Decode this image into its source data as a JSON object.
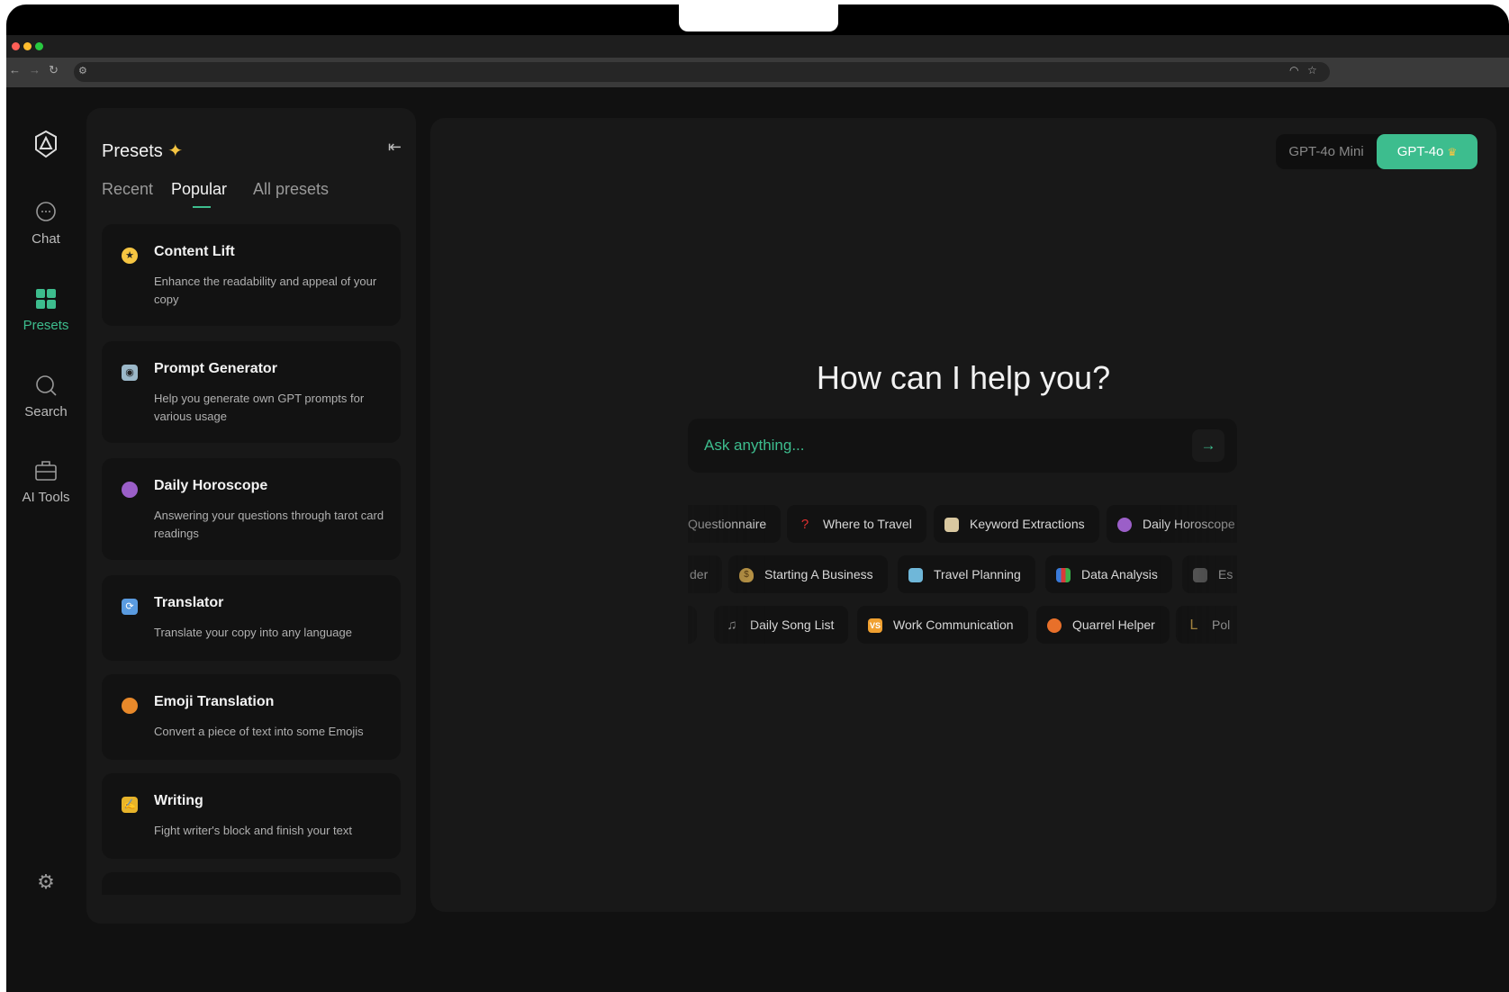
{
  "browser": {
    "traffic_lights": [
      "#ff5f57",
      "#febc2e",
      "#28c840"
    ],
    "icons": [
      "back-icon",
      "forward-icon",
      "reload-icon",
      "site-settings-icon",
      "performance-icon",
      "star-icon"
    ]
  },
  "nav": {
    "items": [
      {
        "label": "Chat",
        "icon": "chat-icon"
      },
      {
        "label": "Presets",
        "icon": "grid-icon",
        "active": true
      },
      {
        "label": "Search",
        "icon": "search-icon"
      },
      {
        "label": "AI Tools",
        "icon": "toolbox-icon"
      }
    ]
  },
  "accent": "#3dbd8e",
  "presets": {
    "title": "Presets",
    "title_icon": "sparkles-icon",
    "tabs": [
      "Recent",
      "Popular",
      "All presets"
    ],
    "active_tab": "Popular",
    "cards": [
      {
        "title": "Content Lift",
        "desc": "Enhance the readability and appeal of your copy",
        "icon": "star-struck-emoji"
      },
      {
        "title": "Prompt Generator",
        "desc": "Help you generate own GPT prompts for various usage",
        "icon": "robot-emoji"
      },
      {
        "title": "Daily Horoscope",
        "desc": "Answering your questions through tarot card readings",
        "icon": "crystal-ball-emoji"
      },
      {
        "title": "Translator",
        "desc": "Translate your copy into any language",
        "icon": "repeat-emoji"
      },
      {
        "title": "Emoji Translation",
        "desc": "Convert a piece of text into some Emojis",
        "icon": "pumpkin-emoji"
      },
      {
        "title": "Writing",
        "desc": "Fight writer's block and finish your text",
        "icon": "writing-hand-emoji"
      }
    ]
  },
  "main": {
    "models": [
      "GPT-4o Mini",
      "GPT-4o"
    ],
    "active_model": "GPT-4o",
    "heading": "How can I help you?",
    "input_placeholder": "Ask anything...",
    "chip_rows": [
      [
        "Questionnaire",
        "Where to Travel",
        "Keyword Extractions",
        "Daily Horoscope"
      ],
      [
        "der",
        "Starting A Business",
        "Travel Planning",
        "Data Analysis",
        "Es"
      ],
      [
        "",
        "Daily Song List",
        "Work Communication",
        "Quarrel Helper",
        "Pol"
      ]
    ]
  }
}
